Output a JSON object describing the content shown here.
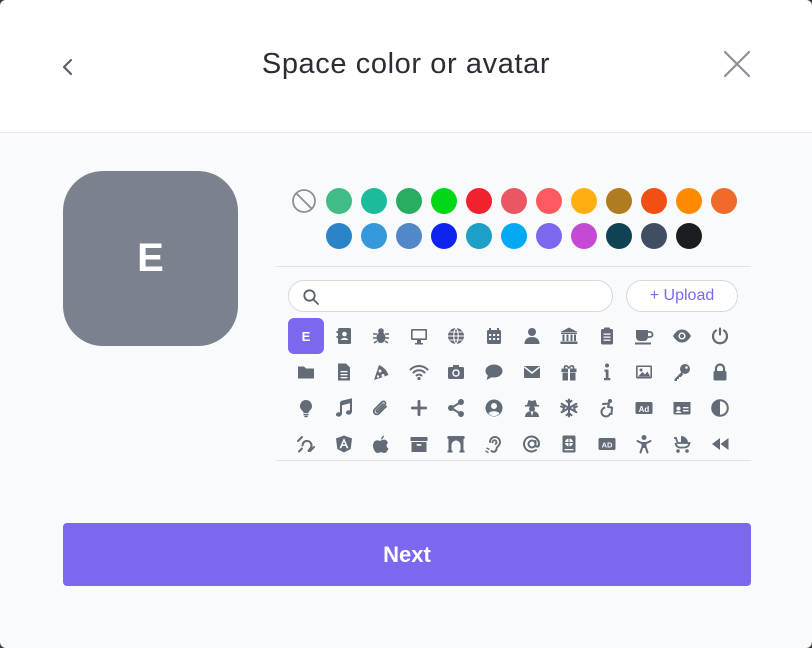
{
  "header": {
    "title": "Space color or avatar",
    "back_icon": "chevron-left-icon",
    "close_icon": "close-icon"
  },
  "avatar": {
    "letter": "E",
    "color": "#7c828d"
  },
  "colors": {
    "row1": [
      "#40bc86",
      "#1abc9c",
      "#27ae60",
      "#00d717",
      "#f0222e",
      "#ea5763",
      "#ff5a5f",
      "#ffb010",
      "#b07c22",
      "#f24f15",
      "#ff8a00",
      "#f06b2a"
    ],
    "row2": [
      "#2b84c7",
      "#3498db",
      "#5388c8",
      "#0e23ef",
      "#1ca0c7",
      "#04a9f4",
      "#7b68ee",
      "#c449d4",
      "#0f4252",
      "#3f4e63",
      "#1c1d20"
    ],
    "none_icon": "ban-icon"
  },
  "search": {
    "placeholder": "",
    "value": ""
  },
  "upload": {
    "label": "+ Upload"
  },
  "icons": [
    {
      "name": "letter-e",
      "letter": "E",
      "selected": true
    },
    {
      "name": "contact-book-icon"
    },
    {
      "name": "bug-icon"
    },
    {
      "name": "desktop-icon"
    },
    {
      "name": "globe-icon"
    },
    {
      "name": "calendar-icon"
    },
    {
      "name": "user-icon"
    },
    {
      "name": "bank-icon"
    },
    {
      "name": "clipboard-icon"
    },
    {
      "name": "coffee-icon"
    },
    {
      "name": "eye-icon"
    },
    {
      "name": "power-icon"
    },
    {
      "name": "folder-icon"
    },
    {
      "name": "document-icon"
    },
    {
      "name": "pizza-icon"
    },
    {
      "name": "wifi-icon"
    },
    {
      "name": "camera-icon"
    },
    {
      "name": "comment-icon"
    },
    {
      "name": "envelope-icon"
    },
    {
      "name": "gift-icon"
    },
    {
      "name": "info-icon"
    },
    {
      "name": "image-icon"
    },
    {
      "name": "key-icon"
    },
    {
      "name": "lock-icon"
    },
    {
      "name": "lightbulb-icon"
    },
    {
      "name": "music-icon"
    },
    {
      "name": "paperclip-icon"
    },
    {
      "name": "plus-icon"
    },
    {
      "name": "share-icon"
    },
    {
      "name": "user-circle-icon"
    },
    {
      "name": "user-secret-icon"
    },
    {
      "name": "snowflake-icon"
    },
    {
      "name": "accessible-icon"
    },
    {
      "name": "ad-icon"
    },
    {
      "name": "id-card-icon"
    },
    {
      "name": "adjust-icon"
    },
    {
      "name": "deaf-icon"
    },
    {
      "name": "angular-icon"
    },
    {
      "name": "apple-icon"
    },
    {
      "name": "archive-icon"
    },
    {
      "name": "archway-icon"
    },
    {
      "name": "hearing-icon"
    },
    {
      "name": "at-icon"
    },
    {
      "name": "atlas-icon"
    },
    {
      "name": "audio-description-icon"
    },
    {
      "name": "baby-icon"
    },
    {
      "name": "baby-carriage-icon"
    },
    {
      "name": "backward-icon"
    }
  ],
  "next_button": {
    "label": "Next"
  }
}
